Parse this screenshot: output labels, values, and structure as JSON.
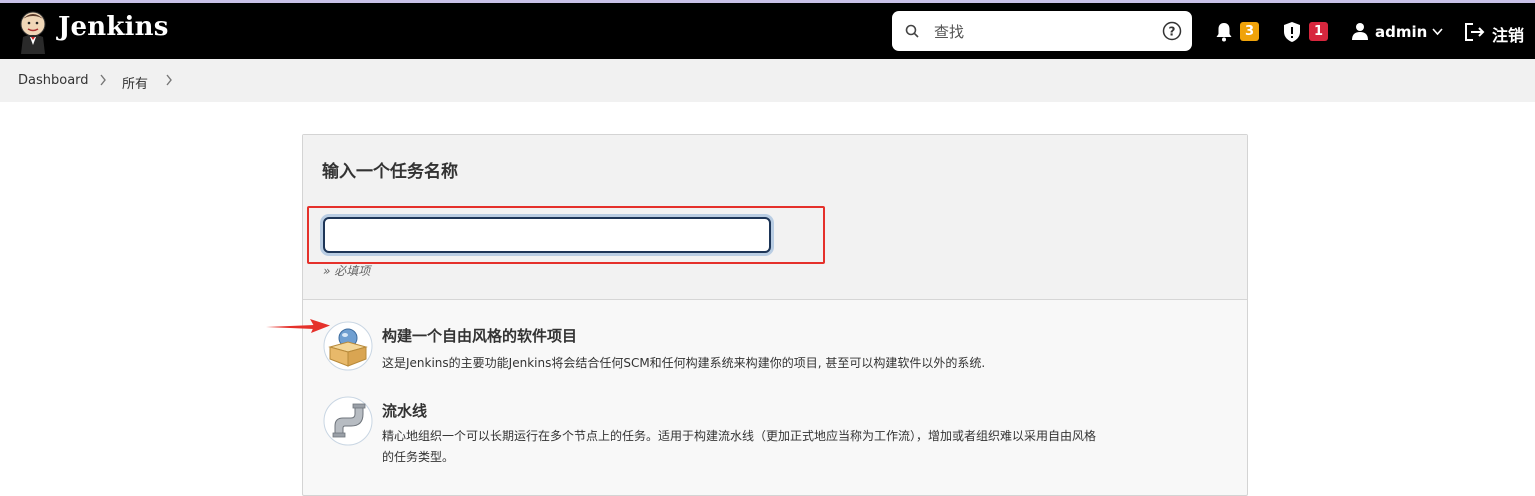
{
  "header": {
    "brand": "Jenkins",
    "search_placeholder": "查找",
    "notifications_count": "3",
    "security_count": "1",
    "user": "admin",
    "logout_label": "注销"
  },
  "breadcrumbs": [
    "Dashboard",
    "所有"
  ],
  "form": {
    "title": "输入一个任务名称",
    "name_value": "",
    "required_hint": "» 必填项"
  },
  "items": [
    {
      "title": "构建一个自由风格的软件项目",
      "description": "这是Jenkins的主要功能Jenkins将会结合任何SCM和任何构建系统来构建你的项目, 甚至可以构建软件以外的系统."
    },
    {
      "title": "流水线",
      "description_line1": "精心地组织一个可以长期运行在多个节点上的任务。适用于构建流水线（更加正式地应当称为工作流），增加或者组织难以采用自由风格",
      "description_line2": "的任务类型。"
    }
  ],
  "colors": {
    "header_bg": "#000000",
    "breadcrumb_bg": "#f1f1f1",
    "warning_badge": "#f0a30a",
    "security_badge": "#d7263d",
    "highlight_box": "#e5312b",
    "input_border": "#1d3557"
  },
  "icons": [
    "jenkins-logo-icon",
    "search-icon",
    "help-icon",
    "bell-icon",
    "shield-icon",
    "user-icon",
    "chevron-down-icon",
    "logout-icon",
    "chevron-right-icon",
    "freestyle-project-icon",
    "pipeline-icon",
    "red-arrow-annotation"
  ]
}
